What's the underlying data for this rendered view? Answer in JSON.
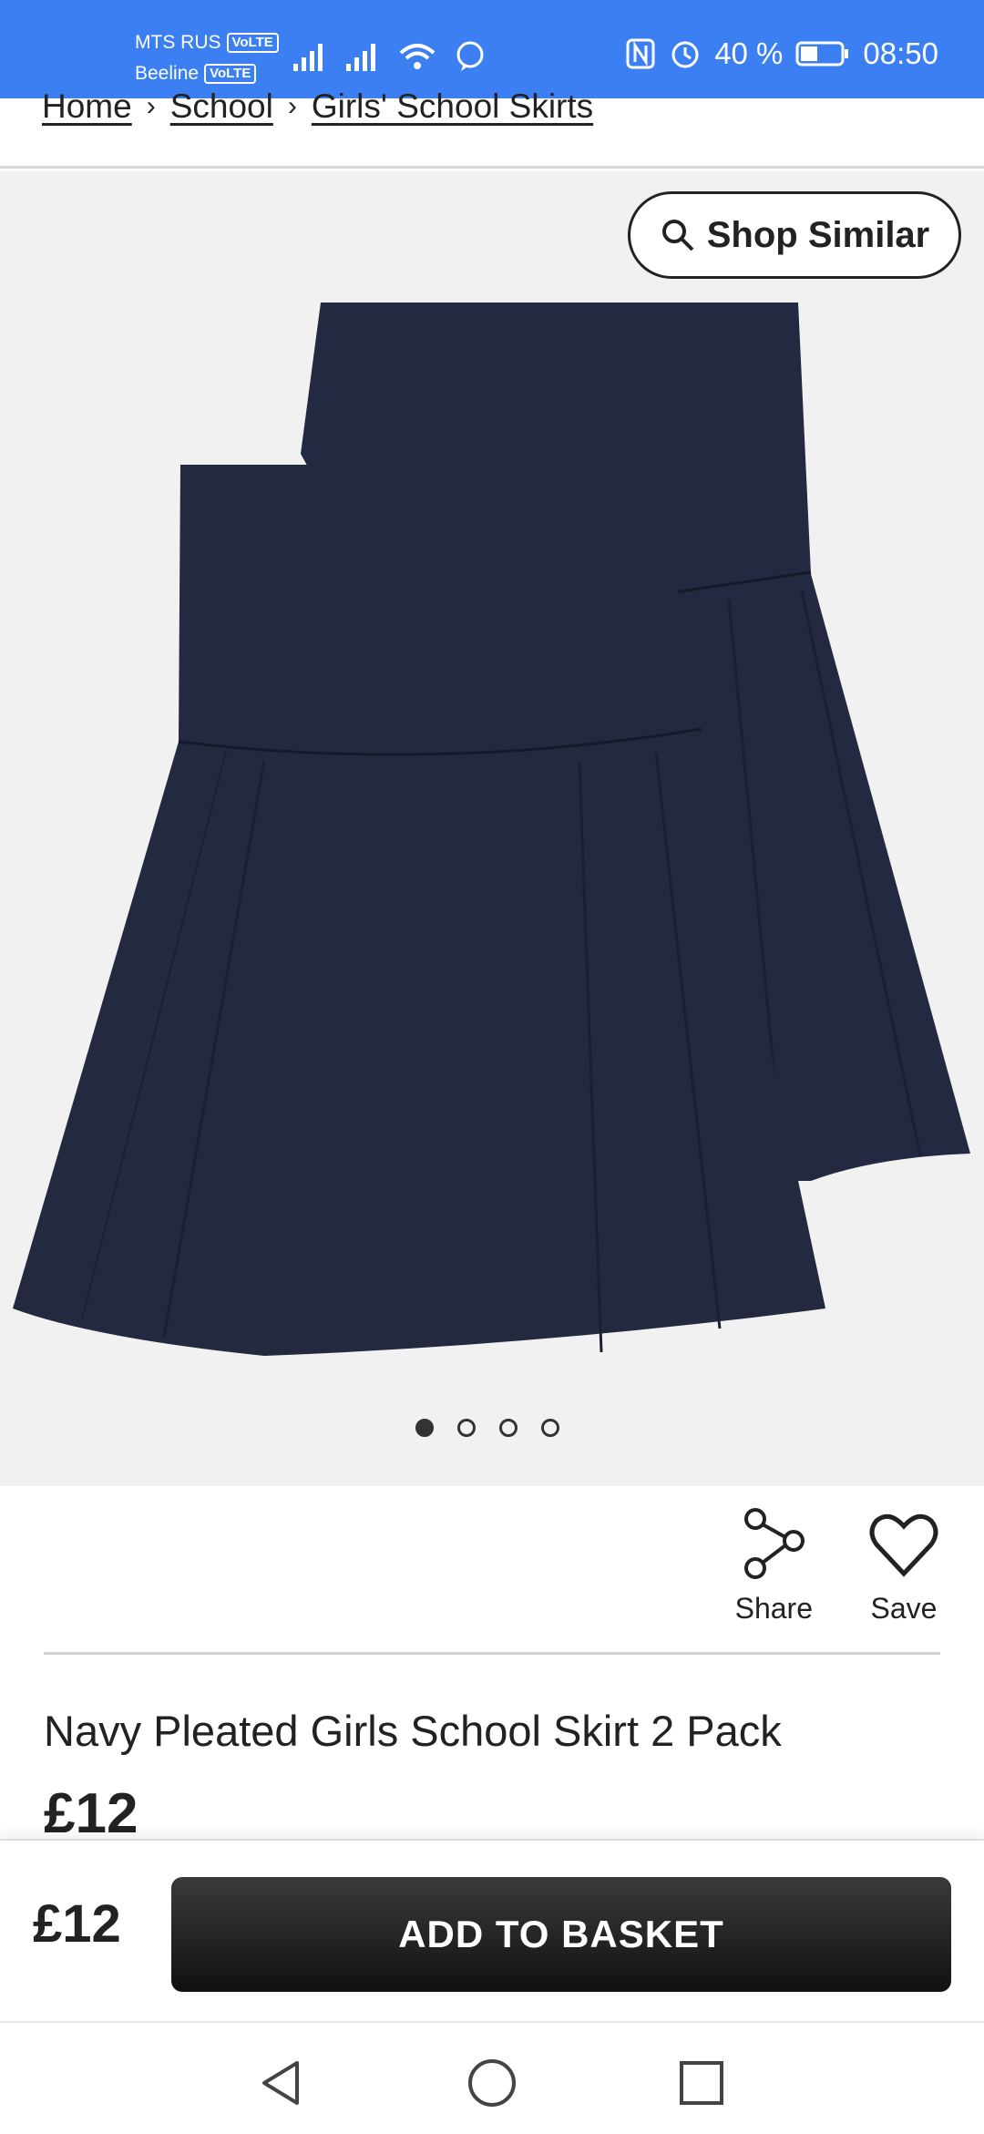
{
  "status_bar": {
    "carrier1": "MTS RUS",
    "carrier2": "Beeline",
    "volte": "VoLTE",
    "battery": "40 %",
    "time": "08:50",
    "color": "#3b7ff2"
  },
  "breadcrumb": {
    "items": [
      "Home",
      "School",
      "Girls' School Skirts"
    ],
    "separator": "›"
  },
  "gallery": {
    "shop_similar_label": "Shop Similar",
    "dot_count": 4,
    "active_dot": 0
  },
  "actions": {
    "share_label": "Share",
    "save_label": "Save"
  },
  "product": {
    "title": "Navy Pleated Girls School Skirt 2 Pack",
    "price": "£12"
  },
  "buy_bar": {
    "price": "£12",
    "add_to_basket_label": "ADD TO BASKET"
  },
  "colors": {
    "skirt": "#232a40",
    "image_background": "#f1f1f1"
  }
}
